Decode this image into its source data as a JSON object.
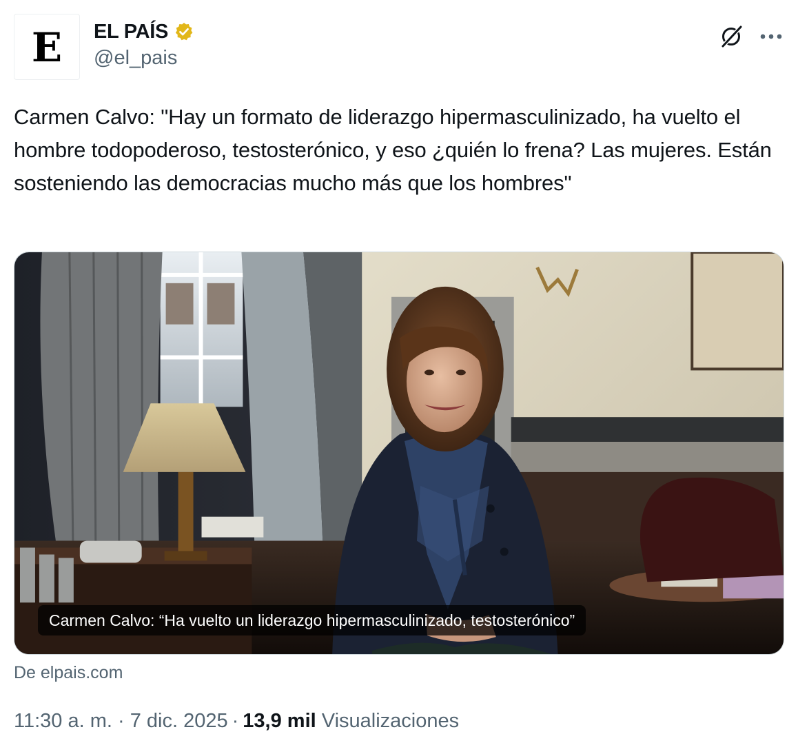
{
  "account": {
    "avatar_letter": "E",
    "display_name": "EL PAÍS",
    "verified_icon": "verified-badge-gold",
    "handle": "@el_pais"
  },
  "actions": {
    "grok_icon": "grok-icon",
    "more_icon": "more-icon"
  },
  "tweet": {
    "text": "Carmen Calvo: \"Hay un formato de liderazgo hipermasculinizado, ha vuelto el hombre todopoderoso, testosterónico, y eso ¿quién lo frena? Las mujeres. Están sosteniendo las democracias mucho más que los hombres\""
  },
  "card": {
    "caption": "Carmen Calvo: “Ha vuelto un liderazgo hipermasculinizado, testosterónico”",
    "source": "De elpais.com"
  },
  "meta": {
    "time": "11:30 a. m.",
    "separator1": "·",
    "date": "7 dic. 2025",
    "separator2": "·",
    "views_count": "13,9 mil",
    "views_label": "Visualizaciones"
  },
  "colors": {
    "text_primary": "#0f1419",
    "text_secondary": "#536471",
    "verified_gold": "#e2b719",
    "border": "#cfd9de"
  }
}
